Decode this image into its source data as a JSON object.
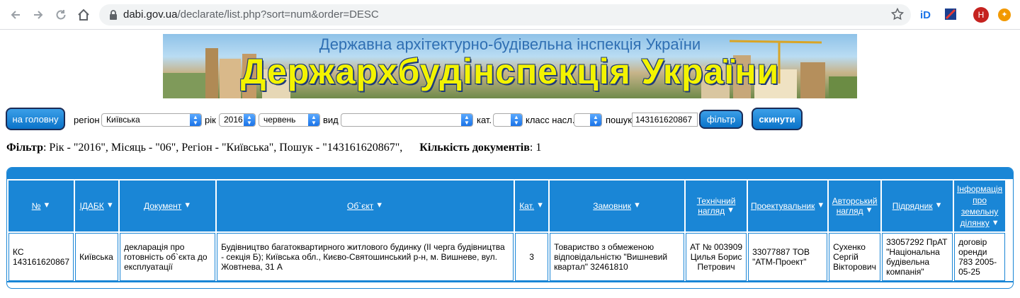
{
  "browser": {
    "url_host": "dabi.gov.ua",
    "url_path": "/declarate/list.php?sort=num&order=DESC",
    "avatar_letter": "H"
  },
  "banner": {
    "subtitle": "Державна архітектурно-будівельна інспекція України",
    "title": "Держархбудінспекція України"
  },
  "toolbar": {
    "home_button": "на головну",
    "region_label": "регіон",
    "region_value": "Київська",
    "year_label": "рік",
    "year_value": "2016",
    "month_value": "червень",
    "type_label": "вид",
    "type_value": "",
    "cat_label": "кат.",
    "cat_value": "",
    "class_label": "класс насл.",
    "class_value": "",
    "search_label": "пошук",
    "search_value": "143161620867",
    "filter_button": "фільтр",
    "reset_button": "скинути"
  },
  "filter_summary": {
    "filter_label": "Фільтр",
    "filter_text": ": Рік - \"2016\", Місяць - \"06\", Регіон - \"Київська\", Пошук - \"143161620867\",",
    "count_label": "Кількість документів",
    "count_value": ": 1"
  },
  "table": {
    "headers": {
      "num": "№",
      "idabk": "ІДАБК",
      "document": "Документ",
      "object": "Об`єкт",
      "cat": "Кат.",
      "customer": "Замовник",
      "tech_l1": "Технічний",
      "tech_l2": "нагляд",
      "designer": "Проектувальник",
      "author_l1": "Авторський",
      "author_l2": "нагляд",
      "contractor": "Підрядник",
      "land_l1": "Інформація",
      "land_l2": "про",
      "land_l3": "земельну",
      "land_l4": "ділянку"
    },
    "row": {
      "num_l1": "КС",
      "num_l2": "143161620867",
      "idabk": "Київська",
      "document": "декларація про готовність об`єкта до експлуатації",
      "object": "Будівництво багатоквартирного житлового будинку (ІІ черга будівництва - секція Б); Київська обл., Києво-Святошинський р-н, м. Вишневе, вул. Жовтнева, 31 А",
      "cat": "3",
      "customer": "Товариство з обмеженою відповідальністю \"Вишневий квартал\" 32461810",
      "tech_l1": "АТ № 003909",
      "tech_l2": "Цилья Борис",
      "tech_l3": "Петрович",
      "designer": "33077887 ТОВ \"АТМ-Проект\"",
      "author_l1": "Сухенко",
      "author_l2": "Сергій",
      "author_l3": "Вікторович",
      "contractor": "33057292 ПрАТ \"Національна будівельна компанія\"",
      "land": "договір оренди 783 2005-05-25"
    }
  },
  "colors": {
    "accent": "#1a86d6",
    "button": "#0a73c9",
    "banner_title": "#f3f300"
  }
}
